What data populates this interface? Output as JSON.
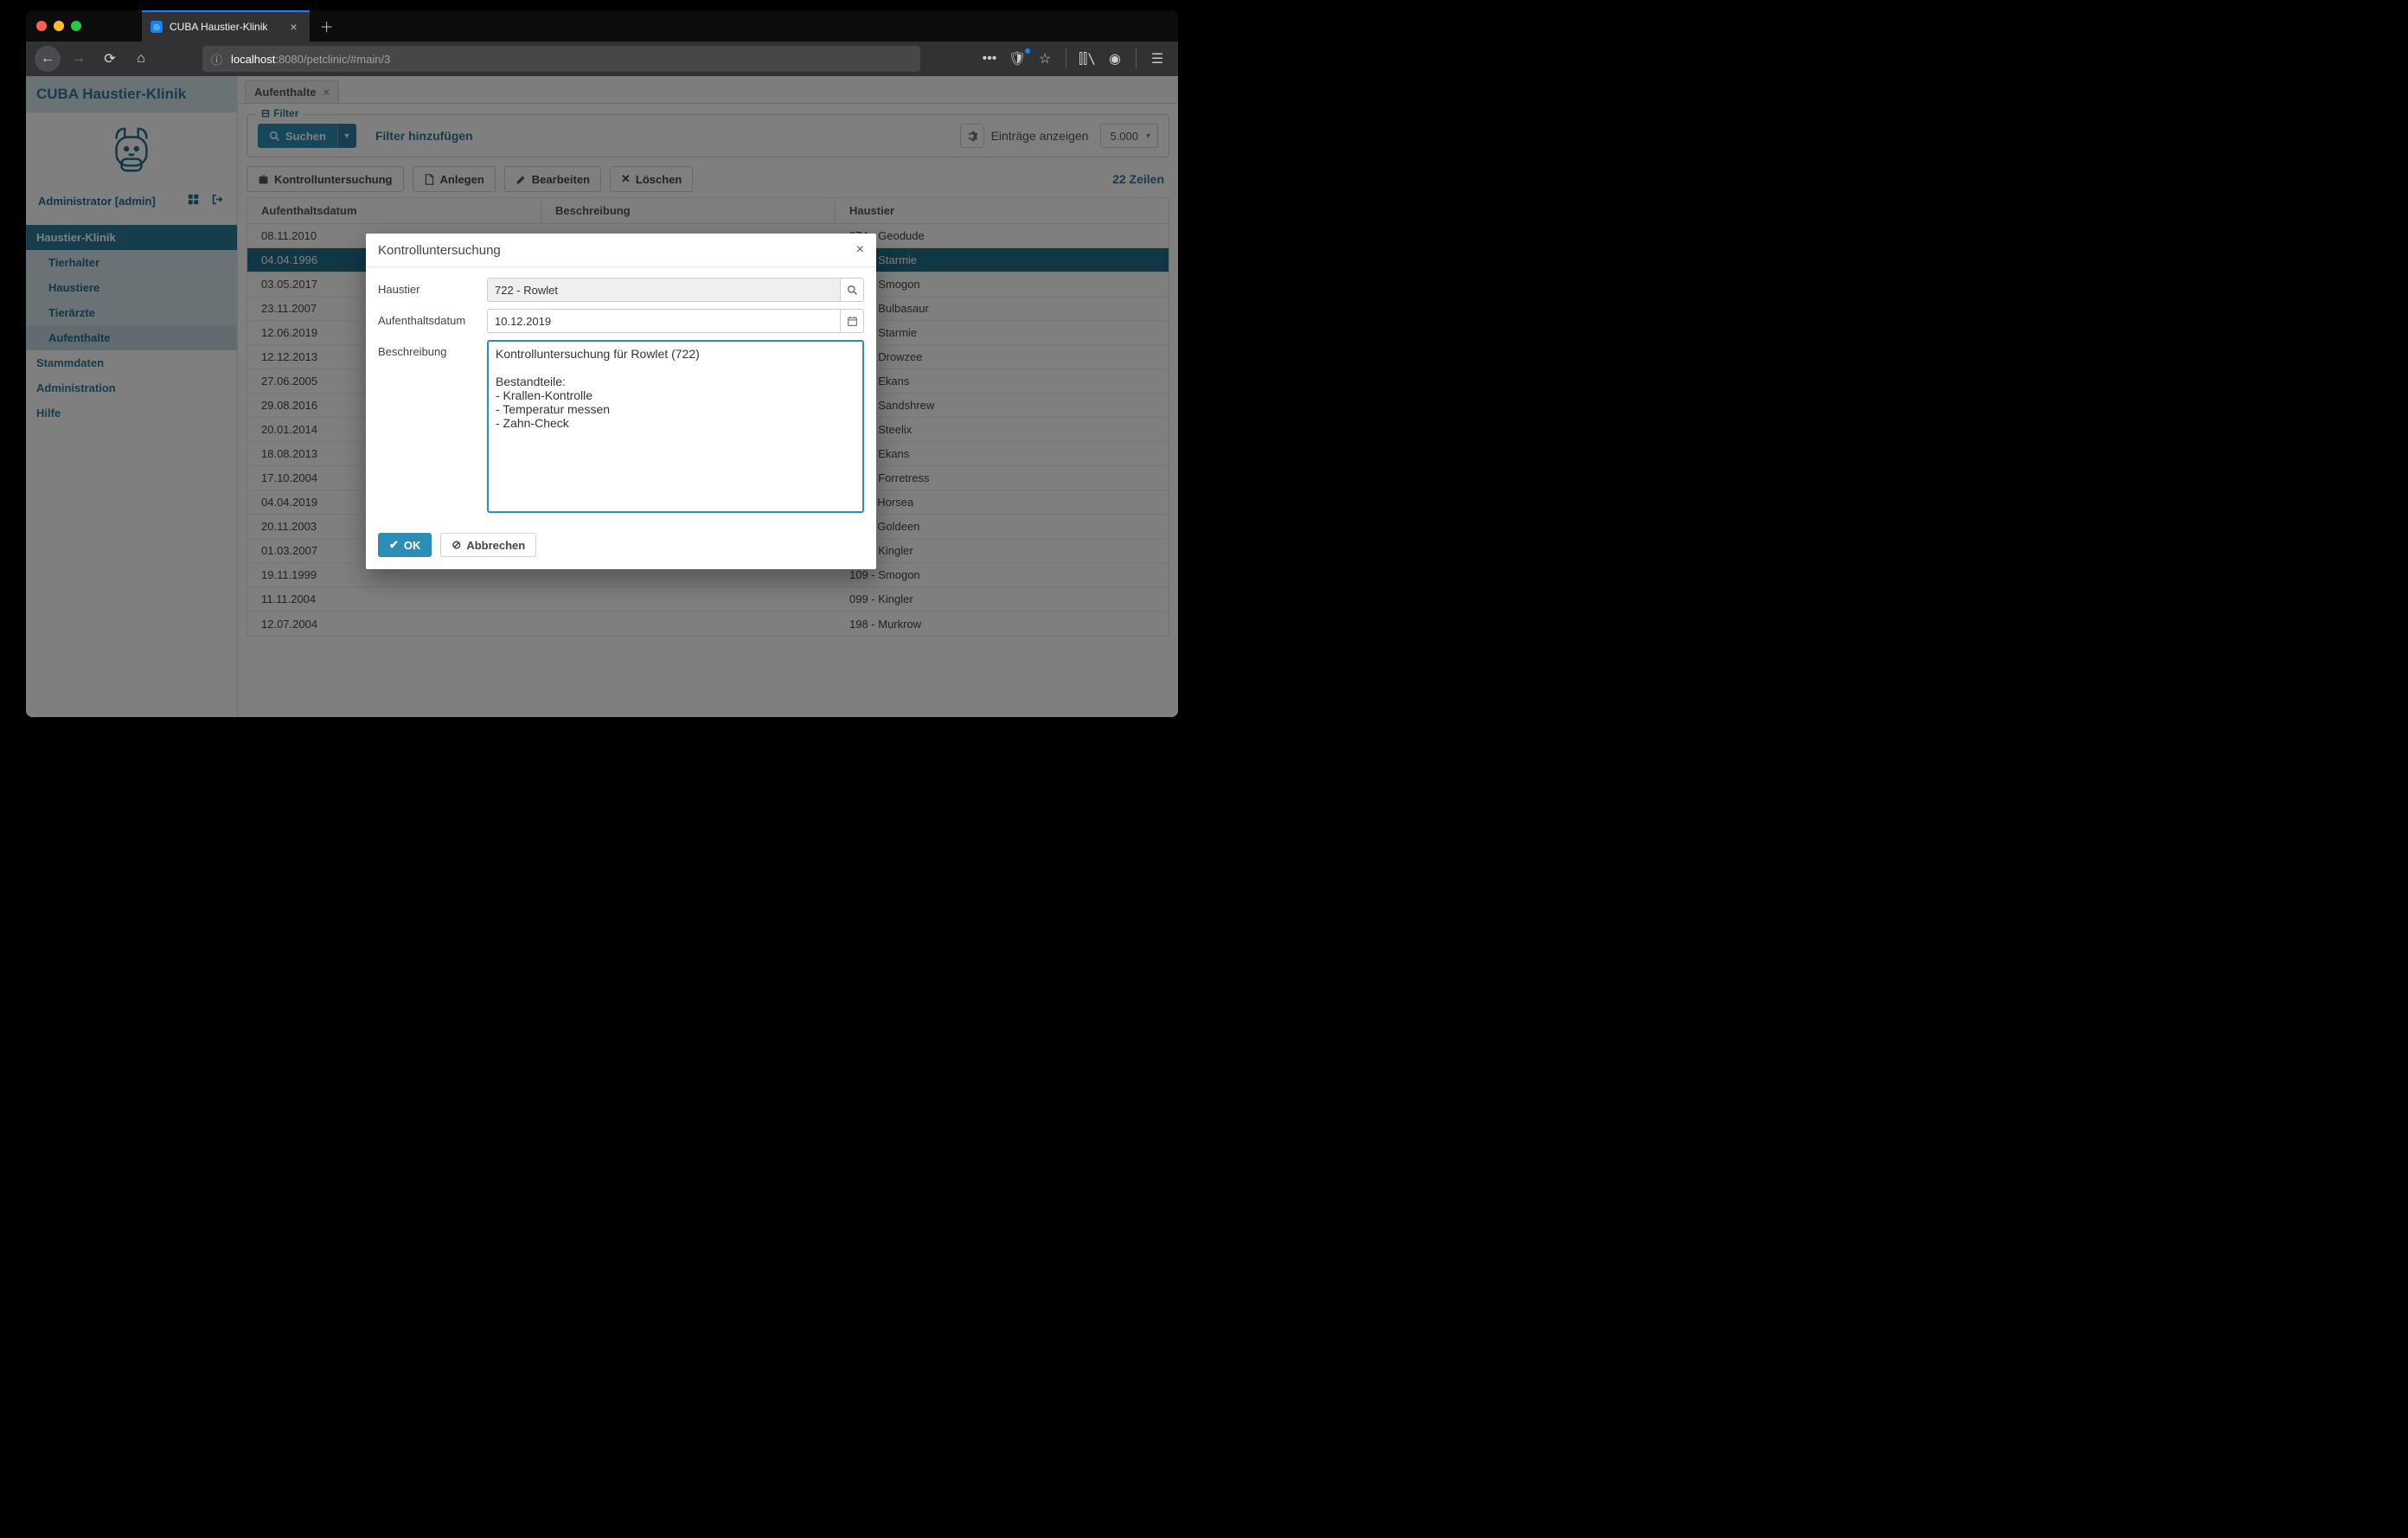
{
  "browser": {
    "tab_title": "CUBA Haustier-Klinik",
    "url_host": "localhost",
    "url_port_path": ":8080/petclinic/#main/3"
  },
  "sidebar": {
    "app_title": "CUBA Haustier-Klinik",
    "admin_label": "Administrator [admin]",
    "groups": {
      "klinik": {
        "label": "Haustier-Klinik",
        "open": true
      },
      "stammdaten": {
        "label": "Stammdaten"
      },
      "administration": {
        "label": "Administration"
      },
      "hilfe": {
        "label": "Hilfe"
      }
    },
    "klinik_items": [
      {
        "label": "Tierhalter"
      },
      {
        "label": "Haustiere"
      },
      {
        "label": "Tierärzte"
      },
      {
        "label": "Aufenthalte"
      }
    ]
  },
  "page": {
    "tab_label": "Aufenthalte",
    "filter": {
      "legend": "Filter",
      "search_label": "Suchen",
      "add_filter_label": "Filter hinzufügen",
      "entries_label": "Einträge anzeigen",
      "entries_value": "5.000"
    },
    "toolbar": {
      "kontroll_label": "Kontrolluntersuchung",
      "anlegen_label": "Anlegen",
      "bearbeiten_label": "Bearbeiten",
      "loeschen_label": "Löschen",
      "rows_count": "22 Zeilen"
    },
    "table": {
      "columns": [
        "Aufenthaltsdatum",
        "Beschreibung",
        "Haustier"
      ],
      "rows": [
        {
          "date": "08.11.2010",
          "desc": "",
          "pet": "074 - Geodude",
          "selected": false
        },
        {
          "date": "04.04.1996",
          "desc": "",
          "pet": "121 - Starmie",
          "selected": true
        },
        {
          "date": "03.05.2017",
          "desc": "",
          "pet": "109 - Smogon",
          "selected": false
        },
        {
          "date": "23.11.2007",
          "desc": "",
          "pet": "001 - Bulbasaur",
          "selected": false
        },
        {
          "date": "12.06.2019",
          "desc": "",
          "pet": "121 - Starmie",
          "selected": false
        },
        {
          "date": "12.12.2013",
          "desc": "",
          "pet": "096 - Drowzee",
          "selected": false
        },
        {
          "date": "27.06.2005",
          "desc": "",
          "pet": "023 - Ekans",
          "selected": false
        },
        {
          "date": "29.08.2016",
          "desc": "",
          "pet": "027 - Sandshrew",
          "selected": false
        },
        {
          "date": "20.01.2014",
          "desc": "",
          "pet": "208 - Steelix",
          "selected": false
        },
        {
          "date": "18.08.2013",
          "desc": "",
          "pet": "023 - Ekans",
          "selected": false
        },
        {
          "date": "17.10.2004",
          "desc": "",
          "pet": "205 - Forretress",
          "selected": false
        },
        {
          "date": "04.04.2019",
          "desc": "",
          "pet": "116 - Horsea",
          "selected": false
        },
        {
          "date": "20.11.2003",
          "desc": "",
          "pet": "118 - Goldeen",
          "selected": false
        },
        {
          "date": "01.03.2007",
          "desc": "",
          "pet": "099 - Kingler",
          "selected": false
        },
        {
          "date": "19.11.1999",
          "desc": "",
          "pet": "109 - Smogon",
          "selected": false
        },
        {
          "date": "11.11.2004",
          "desc": "",
          "pet": "099 - Kingler",
          "selected": false
        },
        {
          "date": "12.07.2004",
          "desc": "",
          "pet": "198 - Murkrow",
          "selected": false
        }
      ]
    }
  },
  "dialog": {
    "title": "Kontrolluntersuchung",
    "labels": {
      "haustier": "Haustier",
      "datum": "Aufenthaltsdatum",
      "beschreibung": "Beschreibung"
    },
    "values": {
      "haustier": "722 - Rowlet",
      "datum": "10.12.2019",
      "beschreibung": "Kontrolluntersuchung für Rowlet (722)\n\nBestandteile:\n- Krallen-Kontrolle\n- Temperatur messen\n- Zahn-Check"
    },
    "actions": {
      "ok": "OK",
      "cancel": "Abbrechen"
    }
  }
}
